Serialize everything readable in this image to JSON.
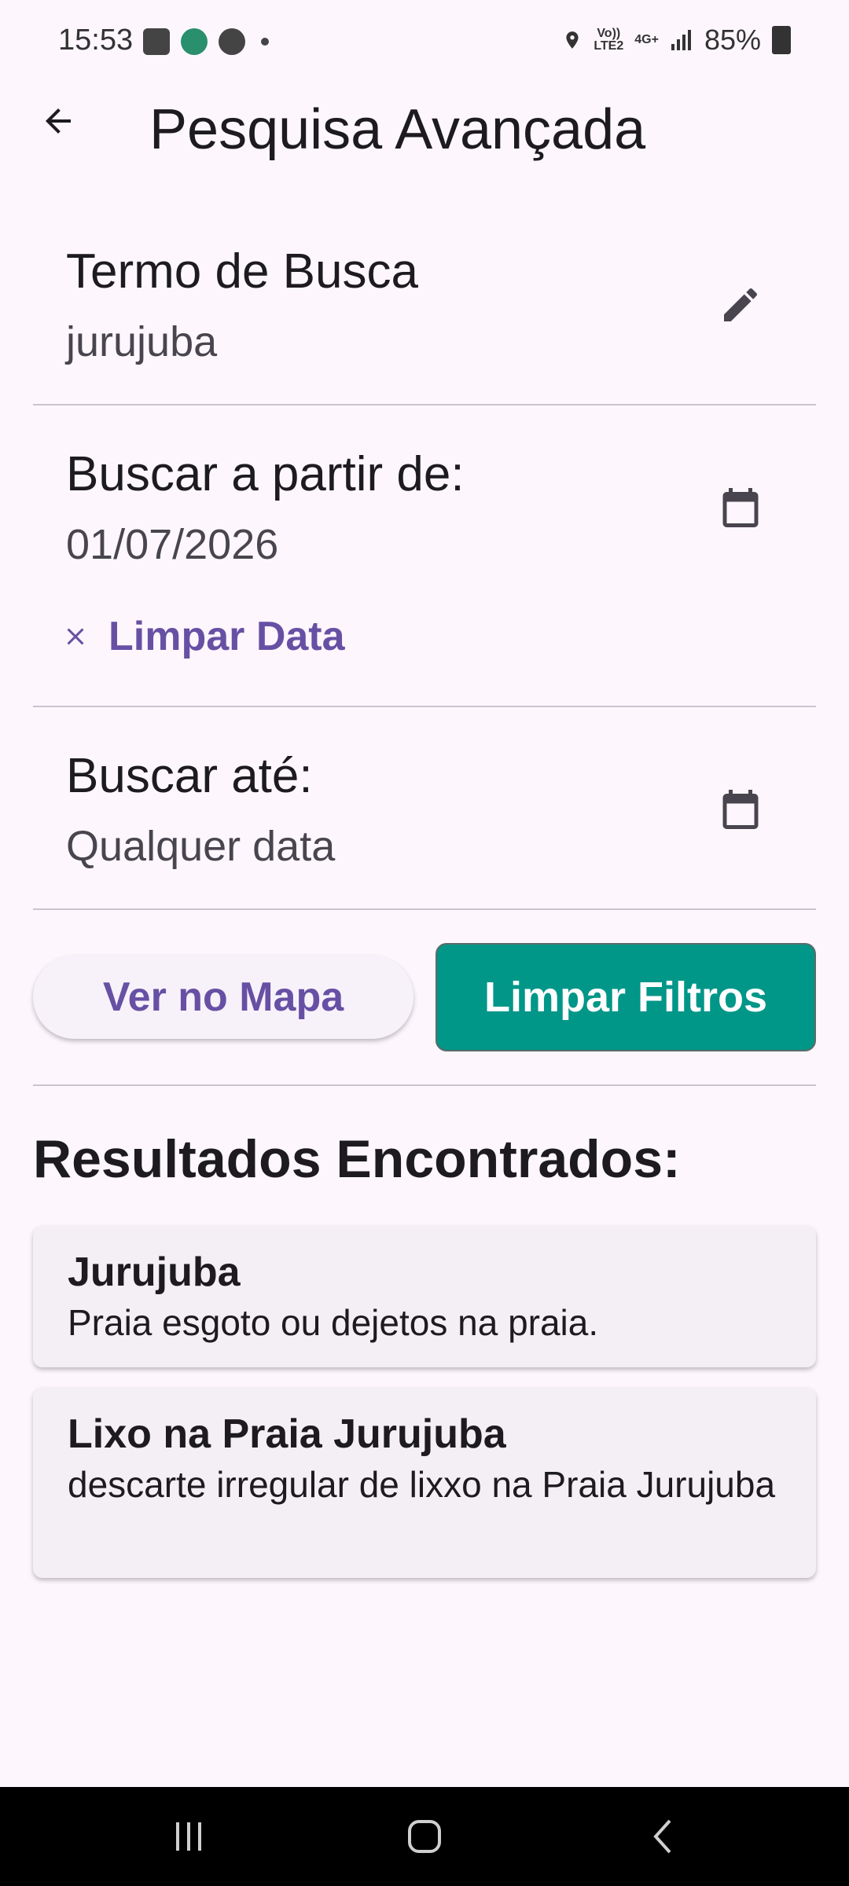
{
  "status": {
    "time": "15:53",
    "battery": "85%",
    "network_top": "Vo))",
    "network_bottom": "LTE2",
    "network_type": "4G+"
  },
  "app_bar": {
    "title": "Pesquisa Avançada"
  },
  "search": {
    "label": "Termo de Busca",
    "value": "jurujuba"
  },
  "date_from": {
    "label": "Buscar a partir de:",
    "value": "01/07/2026",
    "clear_label": "Limpar Data"
  },
  "date_to": {
    "label": "Buscar até:",
    "value": "Qualquer data"
  },
  "buttons": {
    "map": "Ver no Mapa",
    "clear_filters": "Limpar Filtros"
  },
  "results": {
    "title": "Resultados Encontrados:",
    "items": [
      {
        "title": "Jurujuba",
        "description": "Praia esgoto ou dejetos na praia."
      },
      {
        "title": "Lixo na Praia Jurujuba",
        "description": "descarte irregular de lixxo na Praia Jurujuba"
      }
    ]
  },
  "colors": {
    "accent": "#6750a4",
    "primary_button": "#009688",
    "background": "#fdf7fd"
  },
  "icons": [
    "back-arrow-icon",
    "edit-pencil-icon",
    "calendar-icon",
    "close-icon"
  ]
}
